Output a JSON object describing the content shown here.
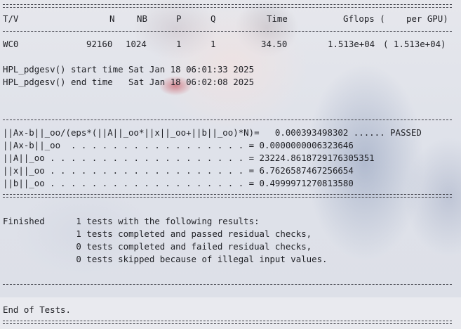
{
  "table": {
    "columns": [
      "T/V",
      "N",
      "NB",
      "P",
      "Q",
      "Time",
      "Gflops (",
      "per GPU)"
    ],
    "row": {
      "tv": "WC0",
      "n": "92160",
      "nb": "1024",
      "p": "1",
      "q": "1",
      "time": "34.50",
      "gflops": "1.513e+04",
      "per_gpu": "( 1.513e+04)"
    }
  },
  "timing": {
    "start_line": "HPL_pdgesv() start time Sat Jan 18 06:01:33 2025",
    "end_line": "HPL_pdgesv() end time   Sat Jan 18 06:02:08 2025"
  },
  "residuals": [
    "||Ax-b||_oo/(eps*(||A||_oo*||x||_oo+||b||_oo)*N)=   0.000393498302 ...... PASSED",
    "||Ax-b||_oo  . . . . . . . . . . . . . . . . . = 0.0000000006323646",
    "||A||_oo . . . . . . . . . . . . . . . . . . . = 23224.8618729176305351",
    "||x||_oo . . . . . . . . . . . . . . . . . . . = 6.7626587467256654",
    "||b||_oo . . . . . . . . . . . . . . . . . . . = 0.4999971270813580"
  ],
  "summary": {
    "line1": "Finished      1 tests with the following results:",
    "line2": "              1 tests completed and passed residual checks,",
    "line3": "              0 tests completed and failed residual checks,",
    "line4": "              0 tests skipped because of illegal input values."
  },
  "footer": {
    "end_text": "End of Tests."
  }
}
